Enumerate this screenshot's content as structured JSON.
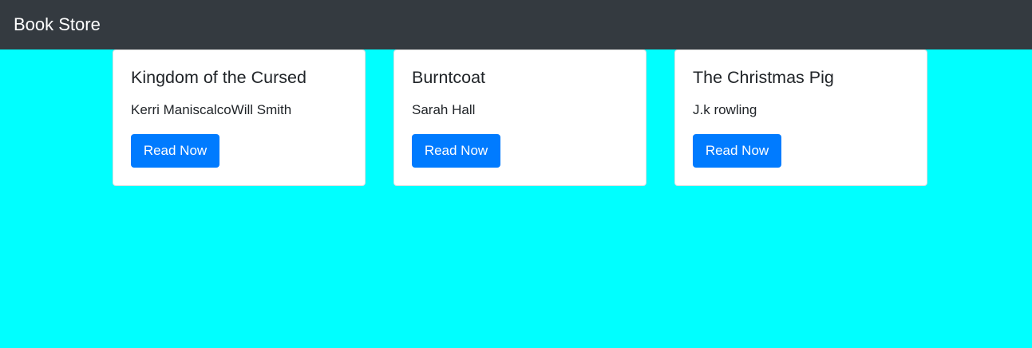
{
  "navbar": {
    "brand": "Book Store"
  },
  "books": [
    {
      "title": "Kingdom of the Cursed",
      "author": "Kerri ManiscalcoWill Smith",
      "button": "Read Now"
    },
    {
      "title": "Burntcoat",
      "author": "Sarah Hall",
      "button": "Read Now"
    },
    {
      "title": "The Christmas Pig",
      "author": "J.k rowling",
      "button": "Read Now"
    }
  ],
  "colors": {
    "background": "#00ffff",
    "navbar": "#343a40",
    "button": "#007bff",
    "card": "#ffffff",
    "text": "#212529"
  }
}
